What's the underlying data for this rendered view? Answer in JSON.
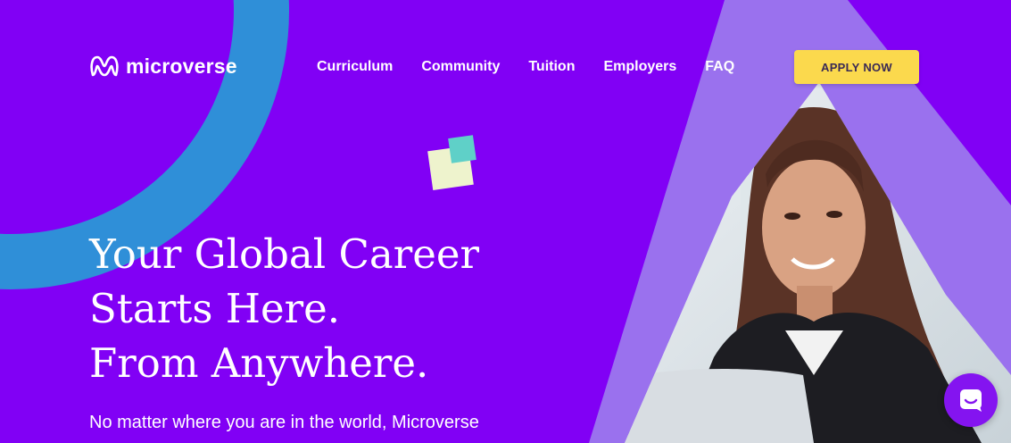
{
  "brand": {
    "name": "microverse"
  },
  "nav": {
    "items": [
      {
        "label": "Curriculum"
      },
      {
        "label": "Community"
      },
      {
        "label": "Tuition"
      },
      {
        "label": "Employers"
      },
      {
        "label": "FAQ"
      }
    ],
    "cta_label": "APPLY NOW"
  },
  "hero": {
    "headline": [
      "Your Global Career",
      "Starts Here.",
      "From Anywhere."
    ],
    "subtext": "No matter where you are in the world, Microverse"
  },
  "colors": {
    "background": "#8100f5",
    "accent_yellow": "#fbd94d",
    "arc_blue": "#2f8fd8",
    "triangle_light": "#9b6cf0"
  },
  "icons": [
    "microverse-logo-icon",
    "chat-icon"
  ]
}
